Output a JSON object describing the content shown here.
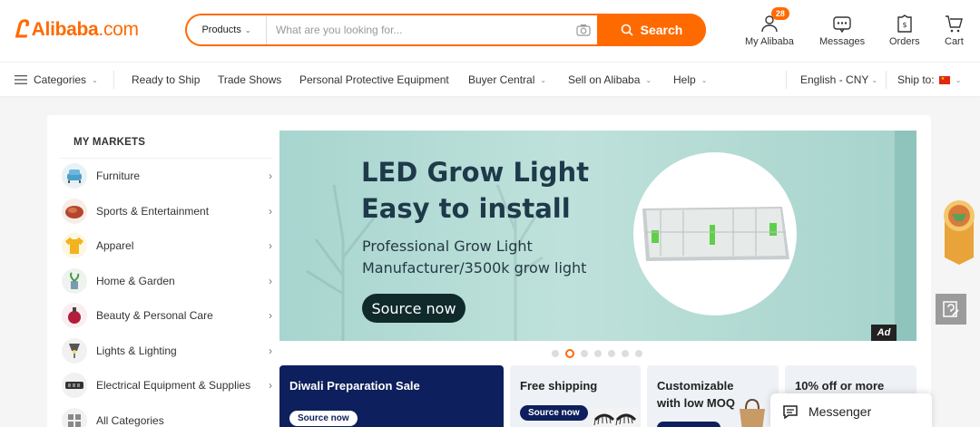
{
  "header": {
    "logo_text": "Alibaba",
    "logo_dotcom": ".com",
    "search": {
      "category": "Products",
      "placeholder": "What are you looking for...",
      "button_label": "Search"
    },
    "actions": [
      {
        "label": "My Alibaba",
        "icon": "user-icon",
        "badge": "28"
      },
      {
        "label": "Messages",
        "icon": "message-icon"
      },
      {
        "label": "Orders",
        "icon": "orders-icon"
      },
      {
        "label": "Cart",
        "icon": "cart-icon"
      }
    ]
  },
  "nav": {
    "categories": "Categories",
    "items": [
      "Ready to Ship",
      "Trade Shows",
      "Personal Protective Equipment",
      "Buyer Central",
      "Sell on Alibaba",
      "Help"
    ],
    "language": "English - CNY",
    "ship_to": "Ship to:"
  },
  "markets": {
    "title": "MY MARKETS",
    "items": [
      {
        "label": "Furniture",
        "icon": "furniture-icon"
      },
      {
        "label": "Sports & Entertainment",
        "icon": "sports-icon"
      },
      {
        "label": "Apparel",
        "icon": "apparel-icon"
      },
      {
        "label": "Home & Garden",
        "icon": "home-garden-icon"
      },
      {
        "label": "Beauty & Personal Care",
        "icon": "beauty-icon"
      },
      {
        "label": "Lights & Lighting",
        "icon": "lighting-icon"
      },
      {
        "label": "Electrical Equipment & Supplies",
        "icon": "electrical-icon"
      },
      {
        "label": "All Categories",
        "icon": "all-categories-icon"
      }
    ]
  },
  "banner": {
    "title_line1": "LED Grow Light",
    "title_line2": "Easy to install",
    "subtitle_line1": "Professional Grow Light",
    "subtitle_line2": "Manufacturer/3500k grow light",
    "button": "Source now",
    "ad_tag": "Ad",
    "slide_count": 7,
    "active_slide": 2
  },
  "promos": [
    {
      "title": "Diwali Preparation Sale",
      "button": "Source now"
    },
    {
      "title": "Free shipping",
      "button": "Source now"
    },
    {
      "title_line1": "Customizable",
      "title_line2": "with low MOQ"
    },
    {
      "title": "10% off or more"
    }
  ],
  "messenger": {
    "label": "Messenger"
  },
  "colors": {
    "accent": "#ff6a00",
    "promo_dark": "#0d1f5c"
  }
}
